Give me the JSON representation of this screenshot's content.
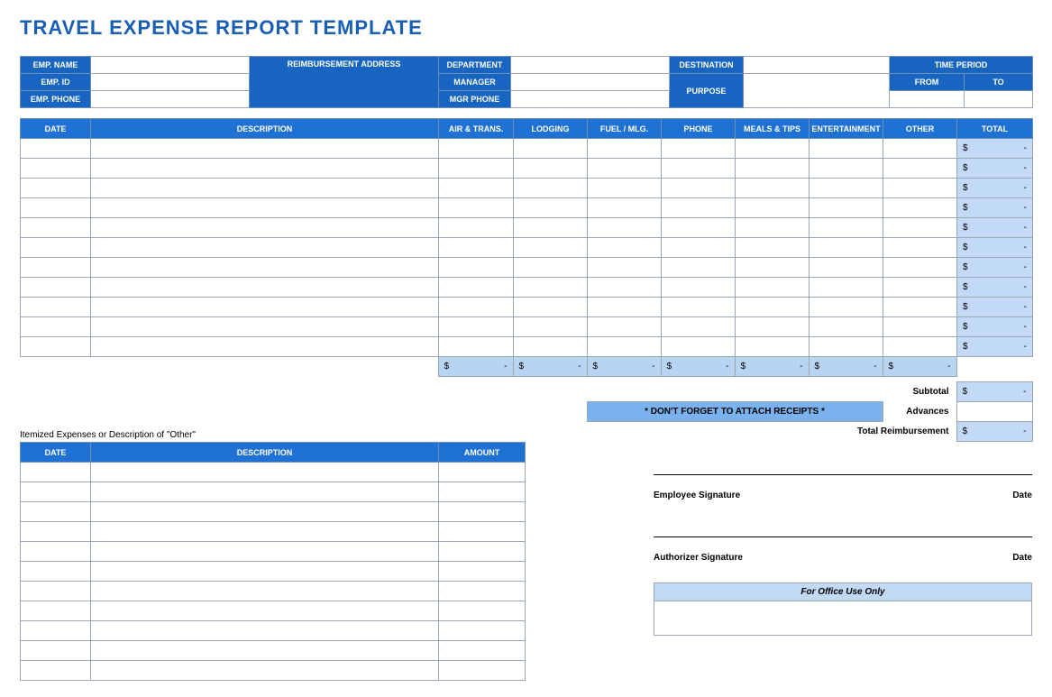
{
  "title": "TRAVEL EXPENSE REPORT TEMPLATE",
  "info": {
    "emp_name": "EMP. NAME",
    "emp_id": "EMP. ID",
    "emp_phone": "EMP. PHONE",
    "reimb_addr": "REIMBURSEMENT ADDRESS",
    "department": "DEPARTMENT",
    "manager": "MANAGER",
    "mgr_phone": "MGR PHONE",
    "destination": "DESTINATION",
    "purpose": "PURPOSE",
    "time_period": "TIME PERIOD",
    "from": "FROM",
    "to": "TO"
  },
  "cols": {
    "date": "DATE",
    "description": "DESCRIPTION",
    "air": "AIR & TRANS.",
    "lodging": "LODGING",
    "fuel": "FUEL / MLG.",
    "phone": "PHONE",
    "meals": "MEALS & TIPS",
    "ent": "ENTERTAINMENT",
    "other": "OTHER",
    "total": "TOTAL"
  },
  "rows": [
    {
      "total": "-"
    },
    {
      "total": "-"
    },
    {
      "total": "-"
    },
    {
      "total": "-"
    },
    {
      "total": "-"
    },
    {
      "total": "-"
    },
    {
      "total": "-"
    },
    {
      "total": "-"
    },
    {
      "total": "-"
    },
    {
      "total": "-"
    },
    {
      "total": "-"
    }
  ],
  "currency": "$",
  "subtotals": {
    "air": "-",
    "lodging": "-",
    "fuel": "-",
    "phone": "-",
    "meals": "-",
    "ent": "-",
    "other": "-"
  },
  "summary": {
    "subtotal_lbl": "Subtotal",
    "subtotal_val": "-",
    "advances_lbl": "Advances",
    "advances_val": "",
    "total_lbl": "Total Reimbursement",
    "total_val": "-"
  },
  "note": "*  DON'T FORGET TO ATTACH RECEIPTS  *",
  "itemized": {
    "title": "Itemized Expenses or Description of \"Other\"",
    "cols": {
      "date": "DATE",
      "description": "DESCRIPTION",
      "amount": "AMOUNT"
    },
    "row_count": 11
  },
  "sig": {
    "employee": "Employee Signature",
    "authorizer": "Authorizer Signature",
    "date": "Date"
  },
  "office": "For Office Use Only"
}
